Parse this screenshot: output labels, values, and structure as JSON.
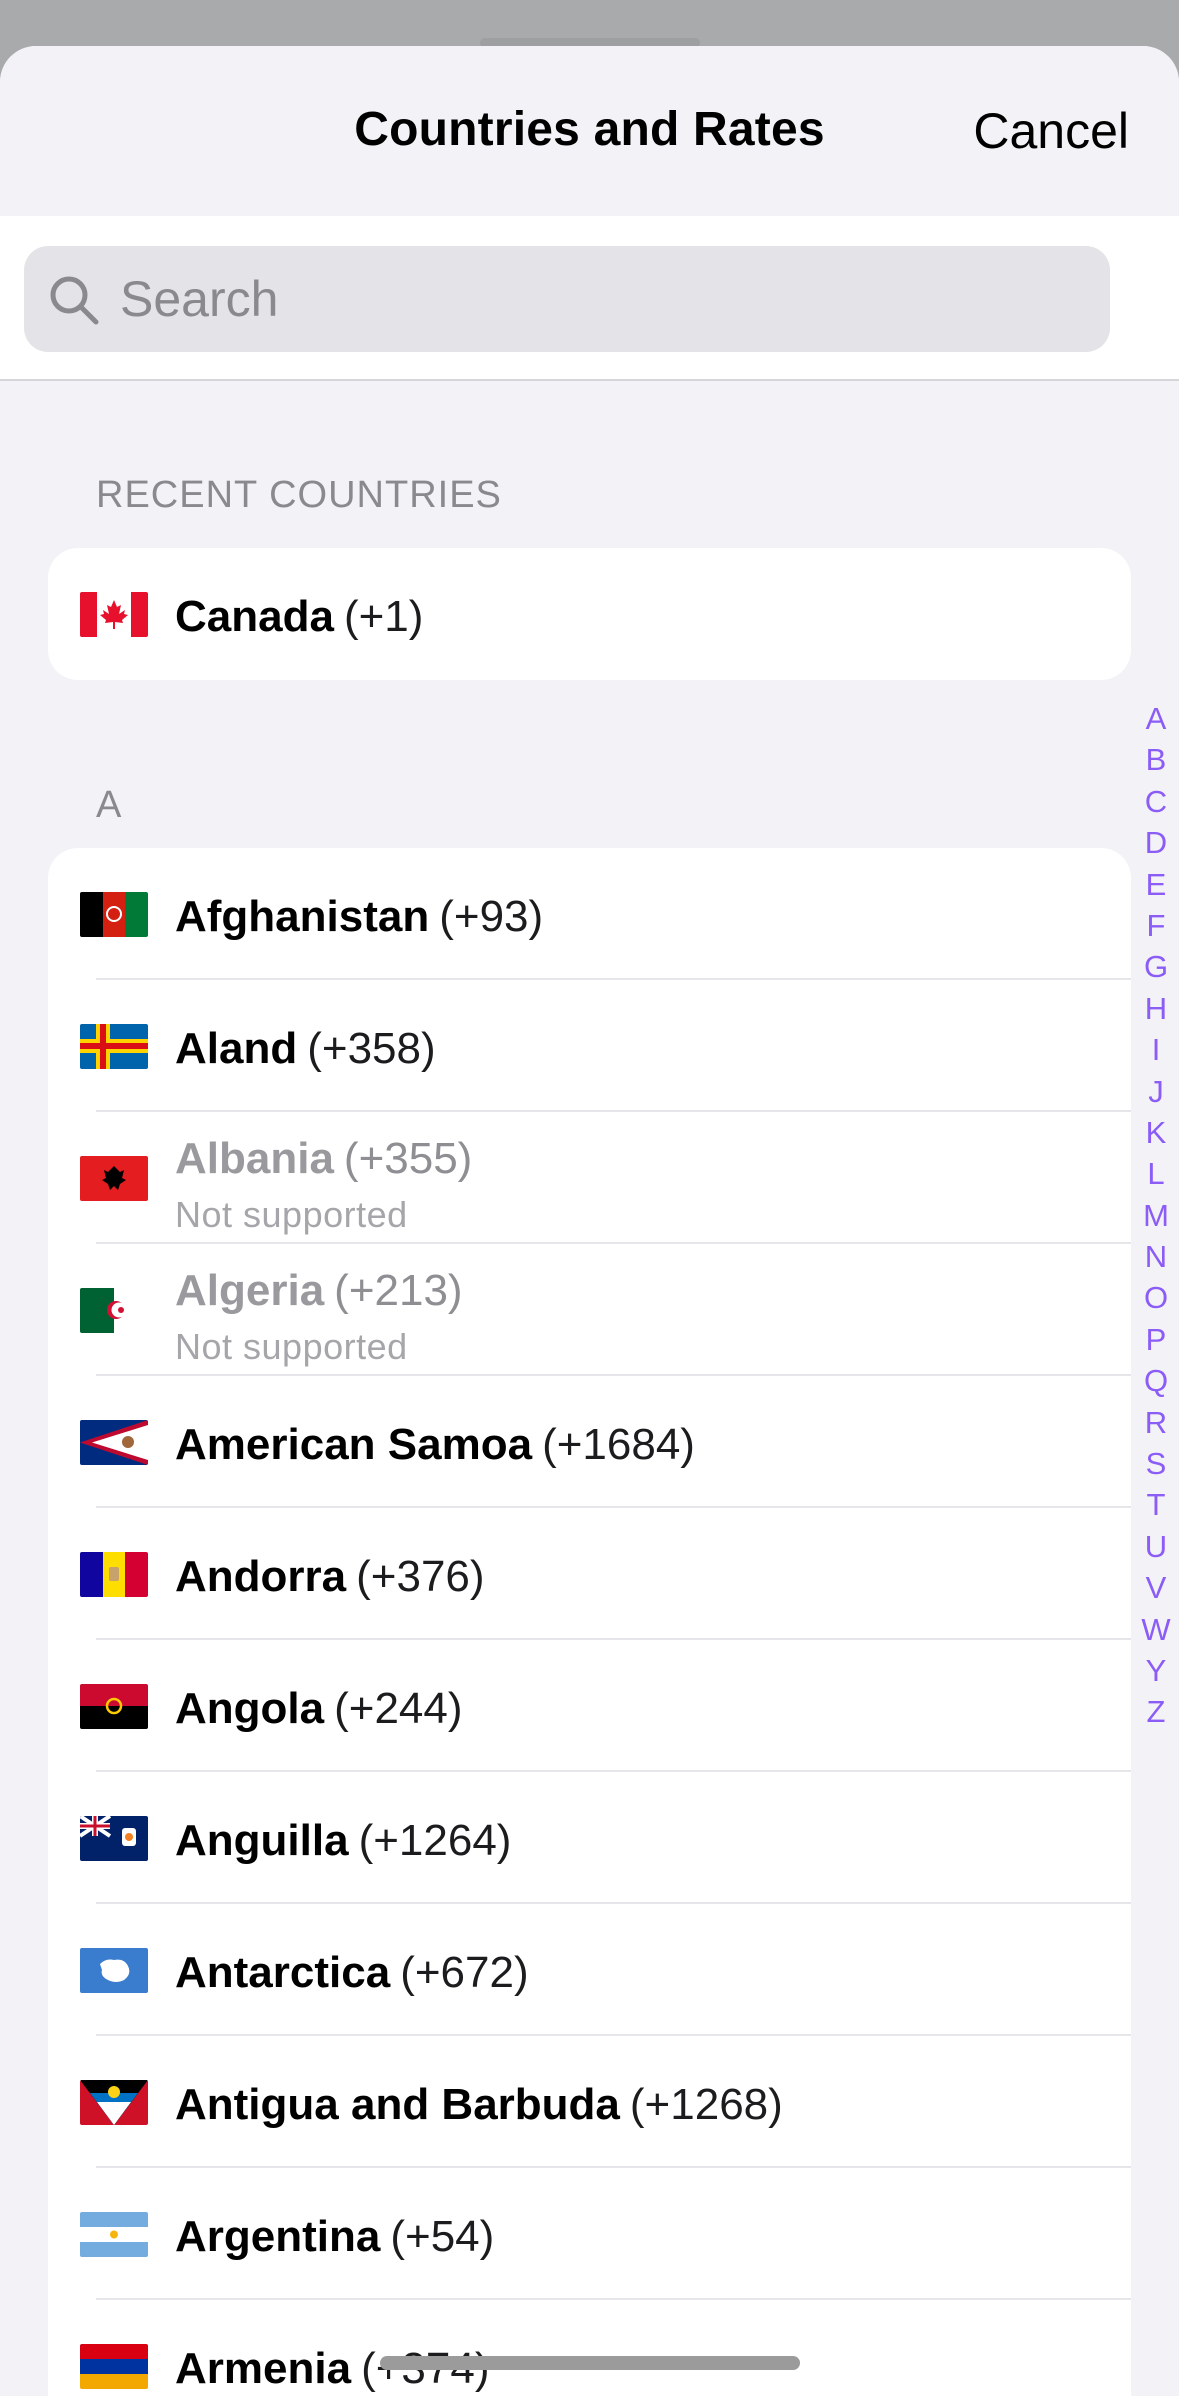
{
  "nav": {
    "title": "Countries and Rates",
    "cancel_label": "Cancel"
  },
  "search": {
    "placeholder": "Search",
    "value": ""
  },
  "recent": {
    "header": "RECENT COUNTRIES",
    "items": [
      {
        "country": "Canada",
        "code": "(+1)",
        "flag": "canada-flag"
      }
    ]
  },
  "section_a": {
    "header": "A",
    "items": [
      {
        "country": "Afghanistan",
        "code": "(+93)",
        "flag": "afghanistan-flag",
        "sub": ""
      },
      {
        "country": "Aland",
        "code": "(+358)",
        "flag": "aland-flag",
        "sub": ""
      },
      {
        "country": "Albania",
        "code": "(+355)",
        "flag": "albania-flag",
        "sub": "Not supported"
      },
      {
        "country": "Algeria",
        "code": "(+213)",
        "flag": "algeria-flag",
        "sub": "Not supported"
      },
      {
        "country": "American Samoa",
        "code": "(+1684)",
        "flag": "american-samoa-flag",
        "sub": ""
      },
      {
        "country": "Andorra",
        "code": "(+376)",
        "flag": "andorra-flag",
        "sub": ""
      },
      {
        "country": "Angola",
        "code": "(+244)",
        "flag": "angola-flag",
        "sub": ""
      },
      {
        "country": "Anguilla",
        "code": "(+1264)",
        "flag": "anguilla-flag",
        "sub": ""
      },
      {
        "country": "Antarctica",
        "code": "(+672)",
        "flag": "antarctica-flag",
        "sub": ""
      },
      {
        "country": "Antigua and Barbuda",
        "code": "(+1268)",
        "flag": "antigua-flag",
        "sub": ""
      },
      {
        "country": "Argentina",
        "code": "(+54)",
        "flag": "argentina-flag",
        "sub": ""
      },
      {
        "country": "Armenia",
        "code": "(+374)",
        "flag": "armenia-flag",
        "sub": ""
      }
    ]
  },
  "index_letters": [
    "A",
    "B",
    "C",
    "D",
    "E",
    "F",
    "G",
    "H",
    "I",
    "J",
    "K",
    "L",
    "M",
    "N",
    "O",
    "P",
    "Q",
    "R",
    "S",
    "T",
    "U",
    "V",
    "W",
    "Y",
    "Z"
  ],
  "colors": {
    "accent": "#8b5cf6",
    "background": "#f2f2f7",
    "card": "#ffffff",
    "muted": "#8a8a8e"
  }
}
